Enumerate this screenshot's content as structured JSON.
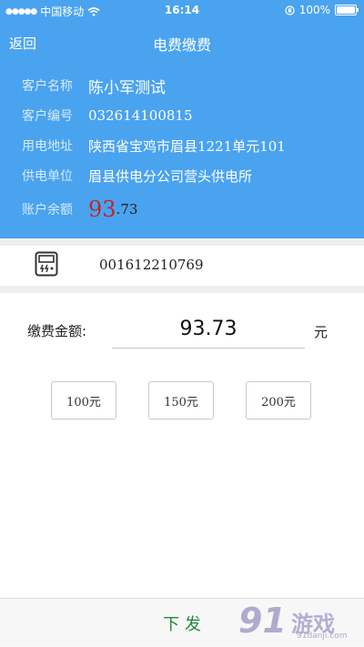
{
  "status_bar": {
    "carrier": "中国移动",
    "time": "16:14",
    "battery": "100%"
  },
  "nav": {
    "back_label": "返回",
    "title": "电费缴费"
  },
  "account": {
    "rows": [
      {
        "label": "客户名称",
        "value": "陈小军测试"
      },
      {
        "label": "客户编号",
        "value": "032614100815"
      },
      {
        "label": "用电地址",
        "value": "陕西省宝鸡市眉县1221单元101"
      },
      {
        "label": "供电单位",
        "value": "眉县供电分公司营头供电所"
      }
    ],
    "balance_label": "账户余额",
    "balance_int": "93",
    "balance_dec": ".73"
  },
  "meter": {
    "icon": "electric-meter-icon",
    "number": "001612210769"
  },
  "payment": {
    "amount_label": "缴费金额:",
    "amount_value": "93.73",
    "unit": "元",
    "quick_amounts": [
      "100元",
      "150元",
      "200元"
    ]
  },
  "footer": {
    "submit_label": "下 发"
  },
  "watermark": {
    "logo_text": "91",
    "brand": "游戏",
    "url": "91danji.com"
  },
  "colors": {
    "header": "#4aa3ef",
    "balance": "#c0262c",
    "submit": "#1f8a3a"
  }
}
